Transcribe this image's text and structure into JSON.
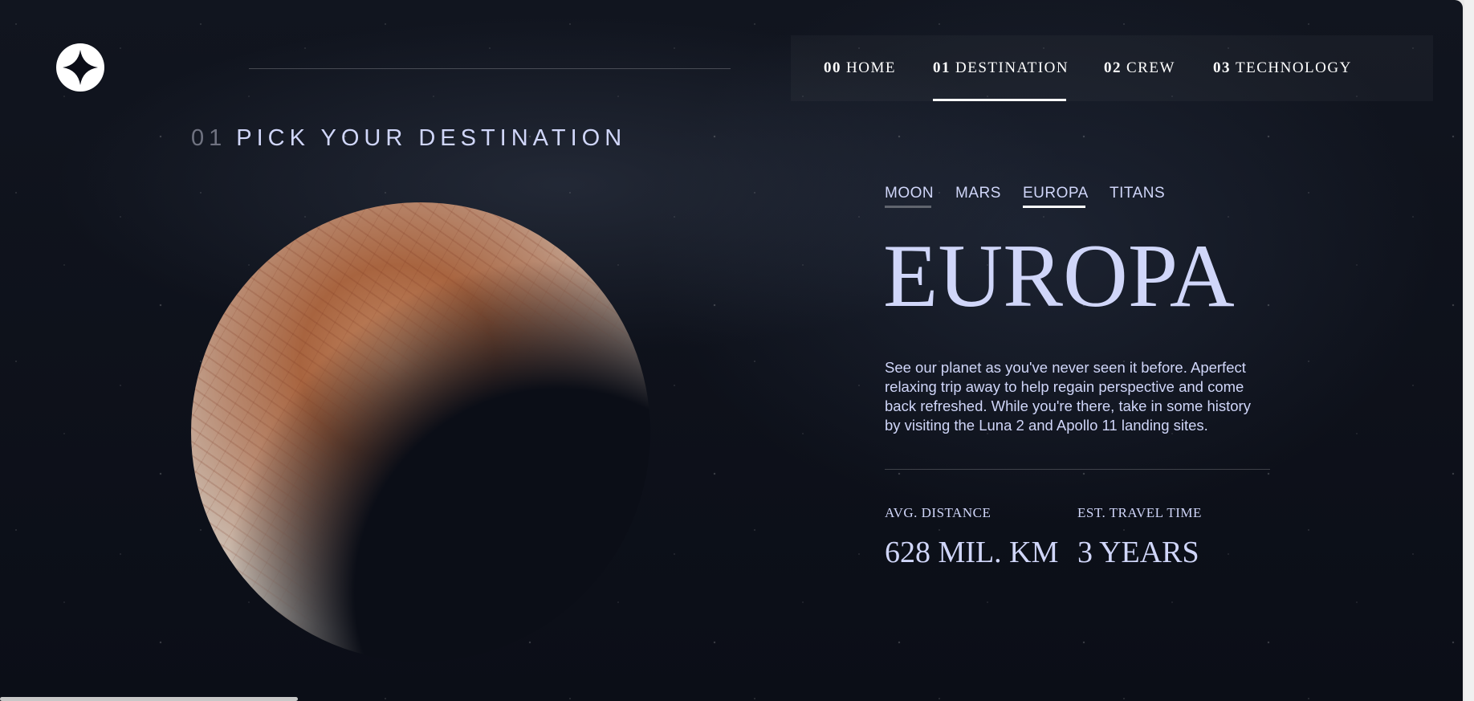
{
  "nav": {
    "items": [
      {
        "num": "00",
        "label": "HOME"
      },
      {
        "num": "01",
        "label": "DESTINATION"
      },
      {
        "num": "02",
        "label": "CREW"
      },
      {
        "num": "03",
        "label": "TECHNOLOGY"
      }
    ],
    "active": "DESTINATION"
  },
  "heading": {
    "num": "01",
    "text": "PICK YOUR DESTINATION"
  },
  "tabs": {
    "items": [
      "MOON",
      "MARS",
      "EUROPA",
      "TITANS"
    ],
    "active": "EUROPA",
    "hovered": "MOON"
  },
  "destination": {
    "name": "EUROPA",
    "description": "See our planet as you've never seen it before. Aperfect relaxing trip away to help regain perspective and come back refreshed. While you're there, take in some history by visiting the Luna 2 and Apollo 11 landing sites.",
    "stats": {
      "distance_label": "AVG. DISTANCE",
      "distance_value": "628 MIL. KM",
      "travel_label": "EST. TRAVEL TIME",
      "travel_value": "3 YEARS"
    }
  },
  "colors": {
    "background": "#0b0e17",
    "text": "#d0d6f9",
    "accent": "#ffffff"
  }
}
